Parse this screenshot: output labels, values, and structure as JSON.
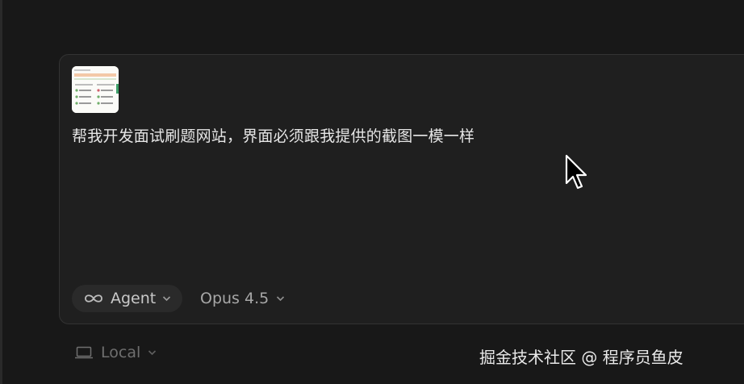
{
  "composer": {
    "prompt_text": "帮我开发面试刷题网站，界面必须跟我提供的截图一模一样",
    "attachment_icon": "screenshot-thumbnail",
    "mode_label": "Agent",
    "mode_icon": "infinity-icon",
    "model_label": "Opus 4.5"
  },
  "footer": {
    "location_label": "Local",
    "location_icon": "laptop-icon"
  },
  "watermark": "掘金技术社区 @ 程序员鱼皮",
  "colors": {
    "background": "#181818",
    "composer_bg": "#1f1f1f",
    "pill_bg": "#2a2a2a",
    "text_primary": "#e6e6e6"
  }
}
